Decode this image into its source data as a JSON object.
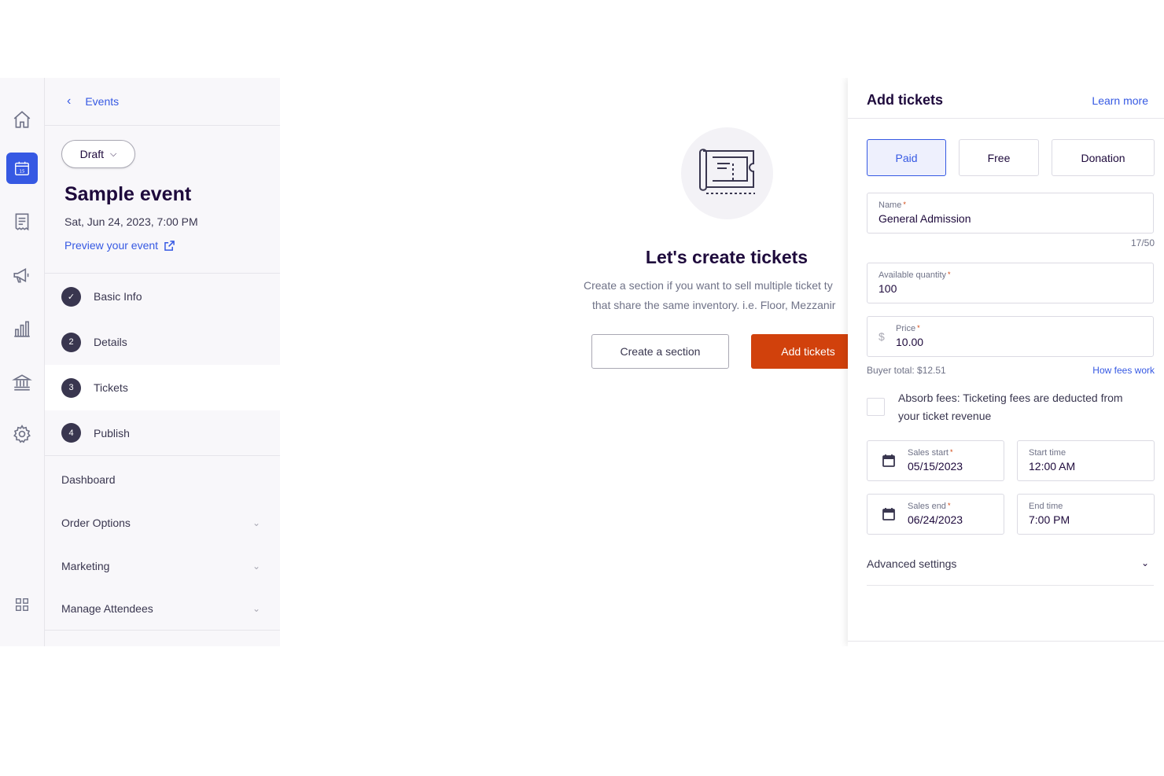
{
  "rail": {
    "icons": [
      "home-icon",
      "calendar-icon",
      "orders-icon",
      "megaphone-icon",
      "bar-chart-icon",
      "bank-icon",
      "gear-icon",
      "apps-grid-icon"
    ],
    "active_color": "#3659e3",
    "calendar_day": "15"
  },
  "sidebar": {
    "back_label": "Events",
    "status_label": "Draft",
    "event_title": "Sample event",
    "event_date": "Sat, Jun 24, 2023, 7:00 PM",
    "preview_label": "Preview your event",
    "steps": [
      {
        "num": "✓",
        "label": "Basic Info"
      },
      {
        "num": "2",
        "label": "Details"
      },
      {
        "num": "3",
        "label": "Tickets"
      },
      {
        "num": "4",
        "label": "Publish"
      }
    ],
    "nav": [
      {
        "label": "Dashboard"
      },
      {
        "label": "Order Options"
      },
      {
        "label": "Marketing"
      },
      {
        "label": "Manage Attendees"
      }
    ]
  },
  "main": {
    "title": "Let's create tickets",
    "desc_line1": "Create a section if you want to sell multiple ticket ty",
    "desc_line2": "that share the same inventory. i.e. Floor, Mezzanir",
    "create_section_label": "Create a section",
    "add_tickets_label": "Add tickets",
    "accent": "#d1410c"
  },
  "panel": {
    "title": "Add tickets",
    "learn_more": "Learn more",
    "types": [
      "Paid",
      "Free",
      "Donation"
    ],
    "selected_type": "Paid",
    "name_label": "Name",
    "name_value": "General Admission",
    "name_counter": "17/50",
    "qty_label": "Available quantity",
    "qty_value": "100",
    "price_label": "Price",
    "currency": "$",
    "price_value": "10.00",
    "buyer_total": "Buyer total: $12.51",
    "how_fees": "How fees work",
    "absorb_line1": "Absorb fees: Ticketing fees are deducted from",
    "absorb_line2": "your ticket revenue",
    "sales_start_label": "Sales start",
    "sales_start_value": "05/15/2023",
    "start_time_label": "Start time",
    "start_time_value": "12:00 AM",
    "sales_end_label": "Sales end",
    "sales_end_value": "06/24/2023",
    "end_time_label": "End time",
    "end_time_value": "7:00 PM",
    "advanced_label": "Advanced settings",
    "required_mark": "*"
  }
}
